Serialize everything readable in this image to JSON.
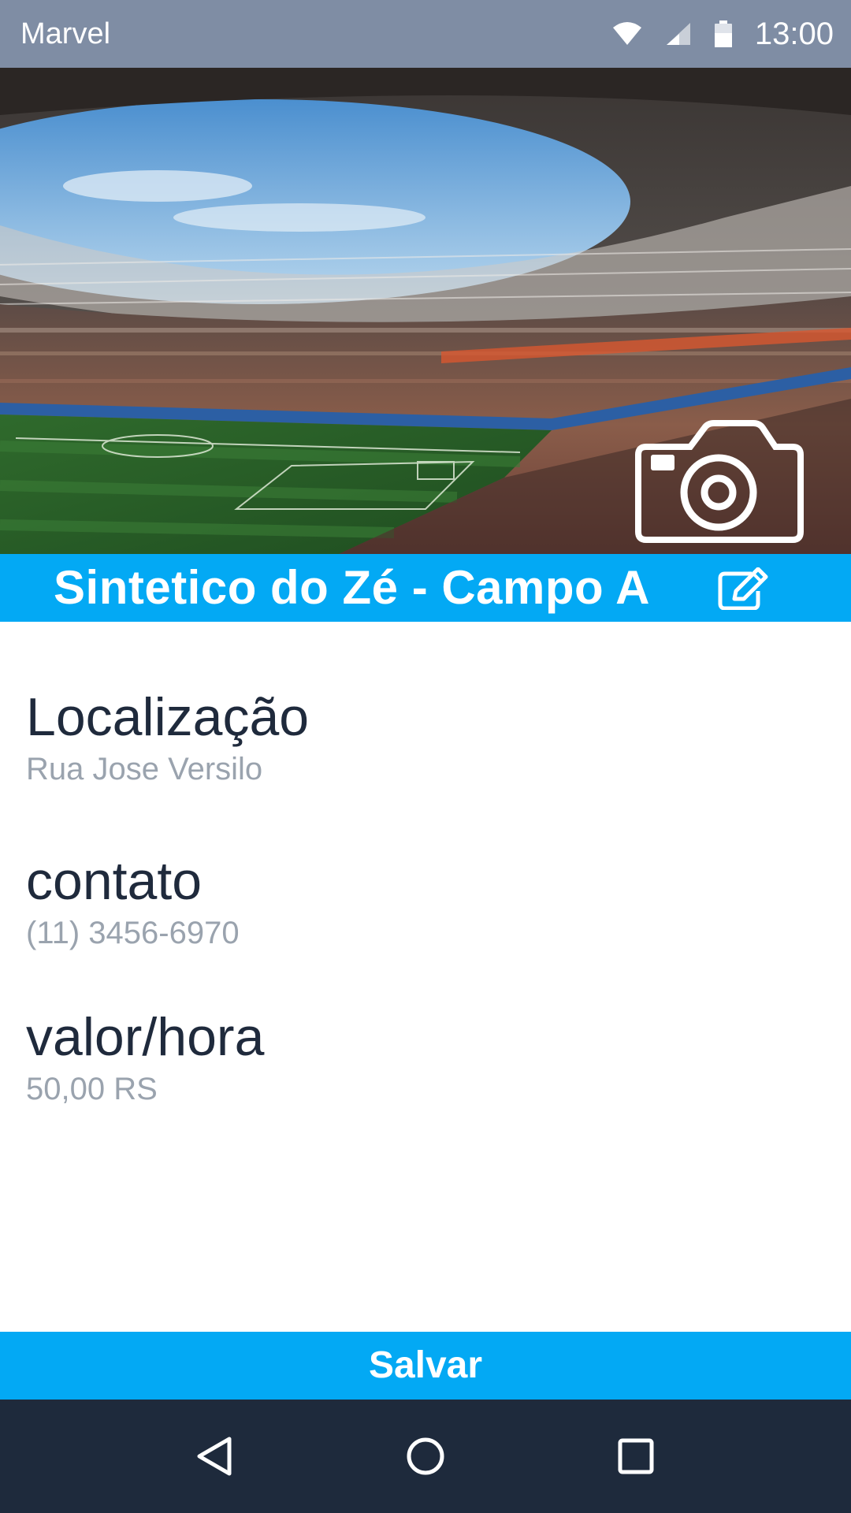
{
  "status_bar": {
    "app_name": "Marvel",
    "time": "13:00",
    "icons": [
      "wifi-icon",
      "signal-icon",
      "battery-icon"
    ]
  },
  "hero": {
    "image": "stadium-photo",
    "camera_icon": "camera-icon"
  },
  "title_bar": {
    "title": "Sintetico do Zé - Campo A",
    "edit_icon": "edit-icon"
  },
  "info": {
    "location": {
      "label": "Localização",
      "value": "Rua Jose Versilo"
    },
    "contact": {
      "label": "contato",
      "value": "(11) 3456-6970"
    },
    "price": {
      "label": "valor/hora",
      "value": "50,00 RS"
    }
  },
  "actions": {
    "save_label": "Salvar"
  },
  "nav_bar": {
    "icons": [
      "back-icon",
      "home-icon",
      "recents-icon"
    ]
  },
  "colors": {
    "accent": "#03a9f4",
    "status_bar": "#7f8da4",
    "nav_bar": "#1e2a3c",
    "label_text": "#1f2a3c",
    "value_text": "#9aa3ae"
  }
}
